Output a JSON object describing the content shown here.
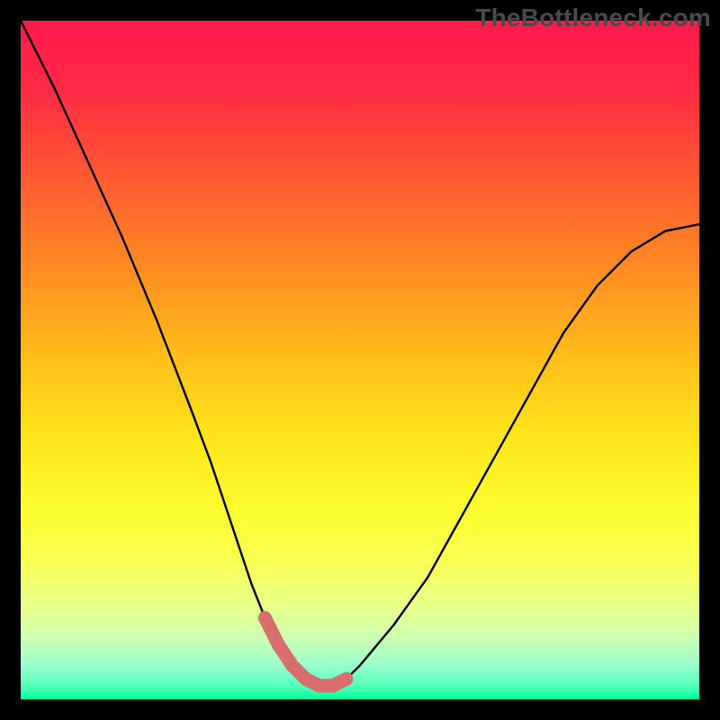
{
  "watermark": "TheBottleneck.com",
  "chart_data": {
    "type": "line",
    "title": "",
    "xlabel": "",
    "ylabel": "",
    "xlim": [
      0,
      100
    ],
    "ylim": [
      0,
      100
    ],
    "grid": false,
    "legend": false,
    "background": {
      "type": "vertical-gradient",
      "stops": [
        {
          "t": 0.0,
          "color": "#ff1744"
        },
        {
          "t": 0.12,
          "color": "#ff2f3f"
        },
        {
          "t": 0.28,
          "color": "#ff6a2a"
        },
        {
          "t": 0.44,
          "color": "#ffa41f"
        },
        {
          "t": 0.6,
          "color": "#ffd21a"
        },
        {
          "t": 0.74,
          "color": "#fff831"
        },
        {
          "t": 0.84,
          "color": "#f4ff64"
        },
        {
          "t": 0.92,
          "color": "#c8ffad"
        },
        {
          "t": 0.96,
          "color": "#8fffc8"
        },
        {
          "t": 1.0,
          "color": "#00ff99"
        }
      ]
    },
    "series": [
      {
        "name": "bottleneck-curve",
        "x": [
          0,
          5,
          10,
          15,
          20,
          25,
          28,
          30,
          32,
          34,
          36,
          38,
          40,
          42,
          44,
          46,
          48,
          50,
          55,
          60,
          65,
          70,
          75,
          80,
          85,
          90,
          95,
          100
        ],
        "y": [
          100,
          90,
          79,
          68,
          56,
          43,
          35,
          29,
          23,
          17,
          12,
          8,
          5,
          3,
          2,
          2,
          3,
          5,
          11,
          18,
          27,
          36,
          45,
          54,
          61,
          66,
          69,
          70
        ]
      }
    ],
    "highlight": {
      "name": "trough-band",
      "x_range": [
        35,
        49
      ],
      "y_range": [
        0,
        8
      ],
      "style": "thick-stroke",
      "color": "#e06666"
    },
    "interpretation": "V-shaped response curve; minimum (optimal) near x≈42; left branch steeper than right branch."
  },
  "colors": {
    "frame": "#000000",
    "curve": "#000000",
    "trough_marker": "#d86e6e",
    "watermark": "#4a4a4a"
  }
}
